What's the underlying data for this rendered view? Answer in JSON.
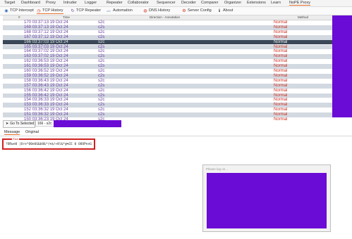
{
  "menu": {
    "items": [
      "Target",
      "Dashboard",
      "Proxy",
      "Intruder",
      "Logger",
      "Repeater",
      "Collaborator",
      "Sequencer",
      "Decoder",
      "Comparer",
      "Organizer",
      "Extensions",
      "Learn",
      "NoPE Proxy"
    ],
    "active": "NoPE Proxy"
  },
  "subtabs": [
    {
      "label": "TCP Intercept",
      "icon": "eye-icon"
    },
    {
      "label": "TCP History",
      "icon": "history-icon",
      "active": true
    },
    {
      "label": "TCP Repeater",
      "icon": "repeater-icon"
    },
    {
      "label": "Automation",
      "icon": "code-icon"
    },
    {
      "label": "DNS History",
      "icon": "dns-icon"
    },
    {
      "label": "Server Config",
      "icon": "config-icon"
    },
    {
      "label": "About",
      "icon": "about-icon"
    }
  ],
  "table": {
    "headers": {
      "num": "#",
      "time": "Time",
      "direction": "Direction - Annotation",
      "method": "Method"
    },
    "rows": [
      {
        "text": "170 03:37:13 19 Oct 24",
        "dir": "s2c",
        "method": "Normal"
      },
      {
        "text": "169 03:37:13 19 Oct 24",
        "dir": "c2s",
        "method": "Normal"
      },
      {
        "text": "168 03:37:12 19 Oct 24",
        "dir": "s2c",
        "method": "Normal"
      },
      {
        "text": "167 03:37:12 19 Oct 24",
        "dir": "c2s",
        "method": "Normal"
      },
      {
        "text": "166 03:37:03 19 Oct 24",
        "dir": "s2c",
        "method": "Normal",
        "selected": true
      },
      {
        "text": "165 03:37:03 19 Oct 24",
        "dir": "c2s",
        "method": "Normal"
      },
      {
        "text": "164 03:37:02 19 Oct 24",
        "dir": "s2c",
        "method": "Normal"
      },
      {
        "text": "163 03:37:02 19 Oct 24",
        "dir": "c2s",
        "method": "Normal"
      },
      {
        "text": "162 03:36:53 19 Oct 24",
        "dir": "s2c",
        "method": "Normal"
      },
      {
        "text": "161 03:36:53 19 Oct 24",
        "dir": "c2s",
        "method": "Normal"
      },
      {
        "text": "160 03:36:52 19 Oct 24",
        "dir": "s2c",
        "method": "Normal"
      },
      {
        "text": "159 03:36:52 19 Oct 24",
        "dir": "c2s",
        "method": "Normal"
      },
      {
        "text": "158 03:36:43 19 Oct 24",
        "dir": "s2c",
        "method": "Normal"
      },
      {
        "text": "157 03:36:43 19 Oct 24",
        "dir": "c2s",
        "method": "Normal"
      },
      {
        "text": "156 03:36:42 19 Oct 24",
        "dir": "s2c",
        "method": "Normal"
      },
      {
        "text": "155 03:36:42 19 Oct 24",
        "dir": "c2s",
        "method": "Normal"
      },
      {
        "text": "154 03:36:33 19 Oct 24",
        "dir": "s2c",
        "method": "Normal"
      },
      {
        "text": "153 03:36:33 19 Oct 24",
        "dir": "c2s",
        "method": "Normal"
      },
      {
        "text": "152 03:36:32 19 Oct 24",
        "dir": "s2c",
        "method": "Normal"
      },
      {
        "text": "151 03:36:32 19 Oct 24",
        "dir": "c2s",
        "method": "Normal"
      },
      {
        "text": "150 03:36:23 19 Oct 24",
        "dir": "s2c",
        "method": "Normal"
      }
    ]
  },
  "goto": {
    "button_label": "Go To Selected",
    "input_value": "166 - s2c"
  },
  "message_tabs": [
    "Message",
    "Original"
  ],
  "raw": {
    "label": "Raw",
    "text": "?ORwe0 |Ore*O0e6G&bO&*(%$/+8l&*@%CE 0 OOOPenG"
  },
  "popup": {
    "title": "Please log on..."
  },
  "colors": {
    "accent": "#e8702a",
    "redaction": "#6a0bd6",
    "highlight_box": "#d02020",
    "selected_row": "#3a4858",
    "method_text": "#d03020"
  }
}
